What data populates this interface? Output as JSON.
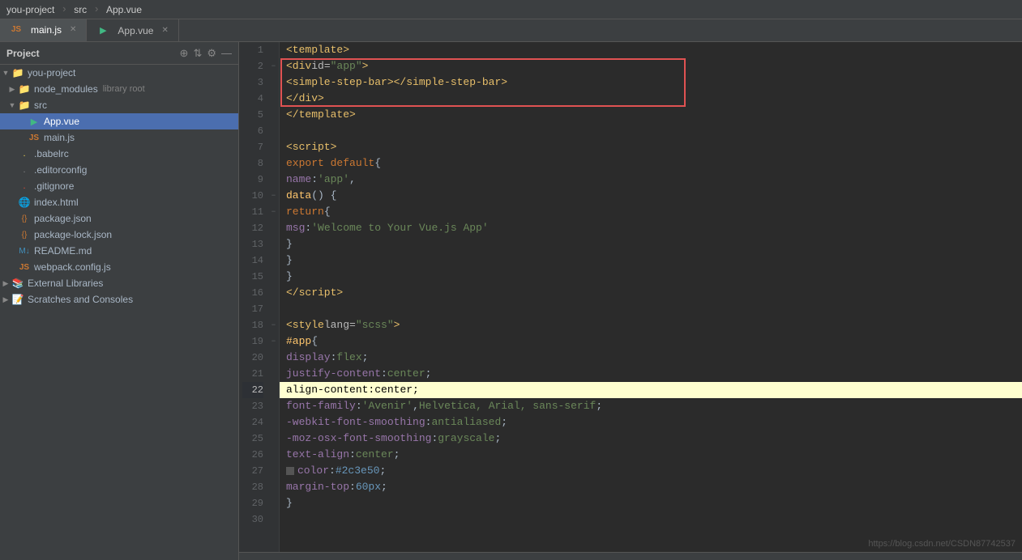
{
  "topbar": {
    "project_label": "you-project",
    "src_path": "src",
    "file_name": "App.vue"
  },
  "tabs": [
    {
      "id": "main-js",
      "label": "main.js",
      "icon": "js",
      "active": true,
      "closable": true
    },
    {
      "id": "app-vue",
      "label": "App.vue",
      "icon": "vue",
      "active": false,
      "closable": true
    }
  ],
  "sidebar": {
    "title": "Project",
    "tree": [
      {
        "id": "you-project",
        "label": "you-project",
        "type": "root-folder",
        "indent": 0,
        "open": true,
        "path": "C:\\Users\\Administrator\\Desktop\\"
      },
      {
        "id": "node_modules",
        "label": "node_modules",
        "type": "folder",
        "indent": 1,
        "open": false,
        "tag": "library root"
      },
      {
        "id": "src",
        "label": "src",
        "type": "folder",
        "indent": 1,
        "open": true
      },
      {
        "id": "App.vue",
        "label": "App.vue",
        "type": "vue",
        "indent": 2,
        "selected": true
      },
      {
        "id": "main.js",
        "label": "main.js",
        "type": "js",
        "indent": 2
      },
      {
        "id": ".babelrc",
        "label": ".babelrc",
        "type": "babel",
        "indent": 1
      },
      {
        "id": ".editorconfig",
        "label": ".editorconfig",
        "type": "editorconfig",
        "indent": 1
      },
      {
        "id": ".gitignore",
        "label": ".gitignore",
        "type": "git",
        "indent": 1
      },
      {
        "id": "index.html",
        "label": "index.html",
        "type": "html",
        "indent": 1
      },
      {
        "id": "package.json",
        "label": "package.json",
        "type": "json",
        "indent": 1
      },
      {
        "id": "package-lock.json",
        "label": "package-lock.json",
        "type": "lock",
        "indent": 1
      },
      {
        "id": "README.md",
        "label": "README.md",
        "type": "md",
        "indent": 1
      },
      {
        "id": "webpack.config.js",
        "label": "webpack.config.js",
        "type": "webpack",
        "indent": 1
      },
      {
        "id": "external-libraries",
        "label": "External Libraries",
        "type": "library",
        "indent": 0,
        "open": false
      },
      {
        "id": "scratches",
        "label": "Scratches and Consoles",
        "type": "scratches",
        "indent": 0,
        "open": false
      }
    ]
  },
  "editor": {
    "lines": [
      {
        "num": 1,
        "content_html": "<span class='c-tag'>&lt;template&gt;</span>"
      },
      {
        "num": 2,
        "content_html": "  <span class='c-tag'>&lt;div</span> <span class='c-attr'>id=</span><span class='c-attr-val'>\"app\"</span><span class='c-tag'>&gt;</span>"
      },
      {
        "num": 3,
        "content_html": "    <span class='c-tag'>&lt;simple-step-bar&gt;&lt;/simple-step-bar&gt;</span>"
      },
      {
        "num": 4,
        "content_html": "  <span class='c-tag'>&lt;/div&gt;</span>"
      },
      {
        "num": 5,
        "content_html": "<span class='c-tag'>&lt;/template&gt;</span>"
      },
      {
        "num": 6,
        "content_html": ""
      },
      {
        "num": 7,
        "content_html": "<span class='c-tag'>&lt;script&gt;</span>"
      },
      {
        "num": 8,
        "content_html": "<span class='c-kw'>export default</span> <span class='c-plain'>{</span>"
      },
      {
        "num": 9,
        "content_html": "  <span class='c-prop'>name</span><span class='c-plain'>:</span> <span class='c-str'>'app'</span><span class='c-plain'>,</span>"
      },
      {
        "num": 10,
        "content_html": "  <span class='c-fn'>data</span> <span class='c-plain'>() {</span>"
      },
      {
        "num": 11,
        "content_html": "    <span class='c-kw'>return</span> <span class='c-plain'>{</span>"
      },
      {
        "num": 12,
        "content_html": "      <span class='c-prop'>msg</span><span class='c-plain'>:</span> <span class='c-str'>'Welcome to Your Vue.js App'</span>"
      },
      {
        "num": 13,
        "content_html": "    <span class='c-plain'>}</span>"
      },
      {
        "num": 14,
        "content_html": "  <span class='c-plain'>}</span>"
      },
      {
        "num": 15,
        "content_html": "<span class='c-plain'>}</span>"
      },
      {
        "num": 16,
        "content_html": "<span class='c-tag'>&lt;/script&gt;</span>"
      },
      {
        "num": 17,
        "content_html": ""
      },
      {
        "num": 18,
        "content_html": "<span class='c-tag'>&lt;style</span> <span class='c-attr'>lang=</span><span class='c-attr-val'>\"scss\"</span><span class='c-tag'>&gt;</span>"
      },
      {
        "num": 19,
        "content_html": "<span class='c-selector'>#app</span> <span class='c-plain'>{</span>"
      },
      {
        "num": 20,
        "content_html": "  <span class='c-css-prop'>display</span><span class='c-plain'>:</span> <span class='c-css-val'>flex</span><span class='c-plain'>;</span>"
      },
      {
        "num": 21,
        "content_html": "  <span class='c-css-prop'>justify-content</span><span class='c-plain'>:</span> <span class='c-css-val'>center</span><span class='c-plain'>;</span>"
      },
      {
        "num": 22,
        "content_html": "  <span class='c-css-prop'>align-content</span><span class='c-plain'>:</span> <span class='c-css-val'>center</span><span class='c-plain'>;</span>",
        "highlighted": true
      },
      {
        "num": 23,
        "content_html": "  <span class='c-css-prop'>font-family</span><span class='c-plain'>:</span> <span class='c-str'>'Avenir'</span><span class='c-plain'>,</span> <span class='c-css-val'>Helvetica, Arial, sans-serif</span><span class='c-plain'>;</span>"
      },
      {
        "num": 24,
        "content_html": "  <span class='c-css-prop'>-webkit-font-smoothing</span><span class='c-plain'>:</span> <span class='c-css-val'>antialiased</span><span class='c-plain'>;</span>"
      },
      {
        "num": 25,
        "content_html": "  <span class='c-css-prop'>-moz-osx-font-smoothing</span><span class='c-plain'>:</span> <span class='c-css-val'>grayscale</span><span class='c-plain'>;</span>"
      },
      {
        "num": 26,
        "content_html": "  <span class='c-css-prop'>text-align</span><span class='c-plain'>:</span> <span class='c-css-val'>center</span><span class='c-plain'>;</span>"
      },
      {
        "num": 27,
        "content_html": "  <span class='c-css-prop'>color</span><span class='c-plain'>:</span> <span class='c-num'>#2c3e50</span><span class='c-plain'>;</span>",
        "has_block": true
      },
      {
        "num": 28,
        "content_html": "  <span class='c-css-prop'>margin-top</span><span class='c-plain'>:</span> <span class='c-num'>60px</span><span class='c-plain'>;</span>"
      },
      {
        "num": 29,
        "content_html": "<span class='c-plain'>}</span>"
      },
      {
        "num": 30,
        "content_html": ""
      }
    ],
    "highlight_box": {
      "top_line": 2,
      "bottom_line": 4,
      "visible": true
    }
  },
  "watermark": "https://blog.csdn.net/CSDN87742537"
}
